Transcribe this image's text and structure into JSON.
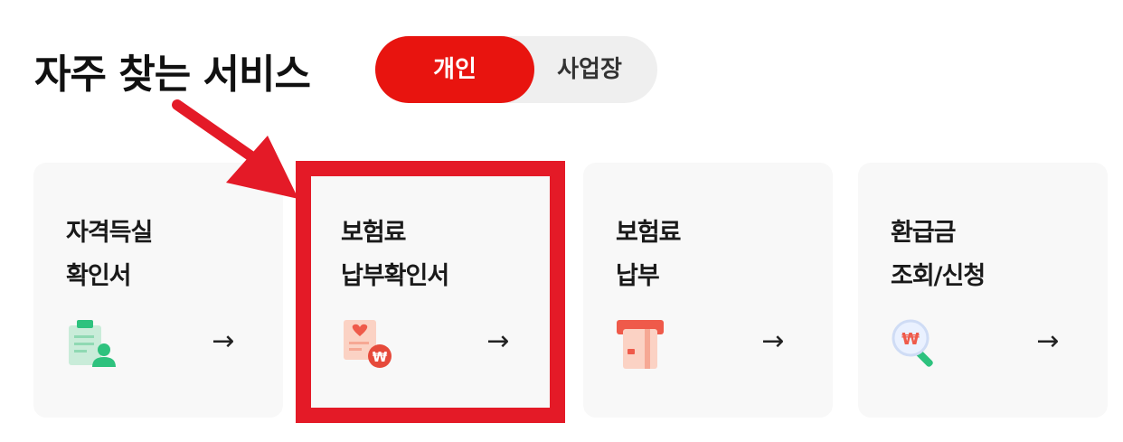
{
  "section": {
    "title": "자주 찾는 서비스"
  },
  "toggle": {
    "personal_label": "개인",
    "business_label": "사업장"
  },
  "cards": [
    {
      "line1": "자격득실",
      "line2": "확인서",
      "icon": "certificate-user-icon",
      "arrow": "→"
    },
    {
      "line1": "보험료",
      "line2": "납부확인서",
      "icon": "payment-receipt-won-icon",
      "arrow": "→"
    },
    {
      "line1": "보험료",
      "line2": "납부",
      "icon": "card-payment-icon",
      "arrow": "→"
    },
    {
      "line1": "환급금",
      "line2": "조회/신청",
      "icon": "won-magnifier-icon",
      "arrow": "→"
    }
  ],
  "colors": {
    "accent": "#e8140f",
    "highlight": "#e41a27",
    "card_bg": "#f8f8f8",
    "green": "#2ec27e"
  }
}
